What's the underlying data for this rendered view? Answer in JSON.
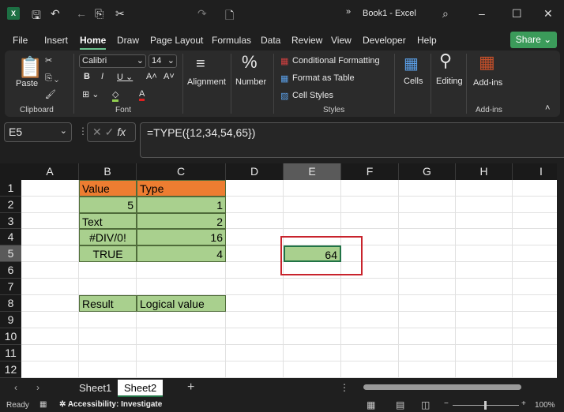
{
  "title": "Book1  -  Excel",
  "menu": [
    "File",
    "Insert",
    "Home",
    "Draw",
    "Page Layout",
    "Formulas",
    "Data",
    "Review",
    "View",
    "Developer",
    "Help"
  ],
  "active_tab": "Home",
  "share": "Share",
  "ribbon": {
    "paste": "Paste",
    "clipboard": "Clipboard",
    "font_name": "Calibri",
    "font_size": "14",
    "font": "Font",
    "alignment": "Alignment",
    "number": "Number",
    "conditional": "Conditional Formatting",
    "format_table": "Format as Table",
    "cell_styles": "Cell Styles",
    "styles": "Styles",
    "cells": "Cells",
    "editing": "Editing",
    "addins": "Add-ins",
    "addins_group": "Add-ins"
  },
  "name_box": "E5",
  "formula": "=TYPE({12,34,54,65})",
  "columns": [
    "A",
    "B",
    "C",
    "D",
    "E",
    "F",
    "G",
    "H",
    "I"
  ],
  "rows": [
    "1",
    "2",
    "3",
    "4",
    "5",
    "6",
    "7",
    "8",
    "9",
    "10",
    "11",
    "12"
  ],
  "selected_cell": "E5",
  "cells": [
    {
      "ref": "B1",
      "v": "Value",
      "fill": "#ed7d31",
      "align": "left"
    },
    {
      "ref": "C1",
      "v": "Type",
      "fill": "#ed7d31",
      "align": "left"
    },
    {
      "ref": "B2",
      "v": "5",
      "fill": "#a9d08e",
      "align": "right"
    },
    {
      "ref": "C2",
      "v": "1",
      "fill": "#a9d08e",
      "align": "right"
    },
    {
      "ref": "B3",
      "v": "Text",
      "fill": "#a9d08e",
      "align": "left"
    },
    {
      "ref": "C3",
      "v": "2",
      "fill": "#a9d08e",
      "align": "right"
    },
    {
      "ref": "B4",
      "v": "#DIV/0!",
      "fill": "#a9d08e",
      "align": "center"
    },
    {
      "ref": "C4",
      "v": "16",
      "fill": "#a9d08e",
      "align": "right"
    },
    {
      "ref": "B5",
      "v": "TRUE",
      "fill": "#a9d08e",
      "align": "center"
    },
    {
      "ref": "C5",
      "v": "4",
      "fill": "#a9d08e",
      "align": "right"
    },
    {
      "ref": "E5",
      "v": "64",
      "fill": "#a9d08e",
      "align": "right"
    },
    {
      "ref": "B8",
      "v": "Result",
      "fill": "#a9d08e",
      "align": "left"
    },
    {
      "ref": "C8",
      "v": "Logical value",
      "fill": "#a9d08e",
      "align": "left"
    }
  ],
  "sheets": [
    "Sheet1",
    "Sheet2"
  ],
  "active_sheet": "Sheet2",
  "status": {
    "ready": "Ready",
    "accessibility": "Accessibility: Investigate",
    "zoom": "100%"
  },
  "colors": {
    "highlight_box": "#c8232c",
    "accent": "#3b9b5a"
  }
}
